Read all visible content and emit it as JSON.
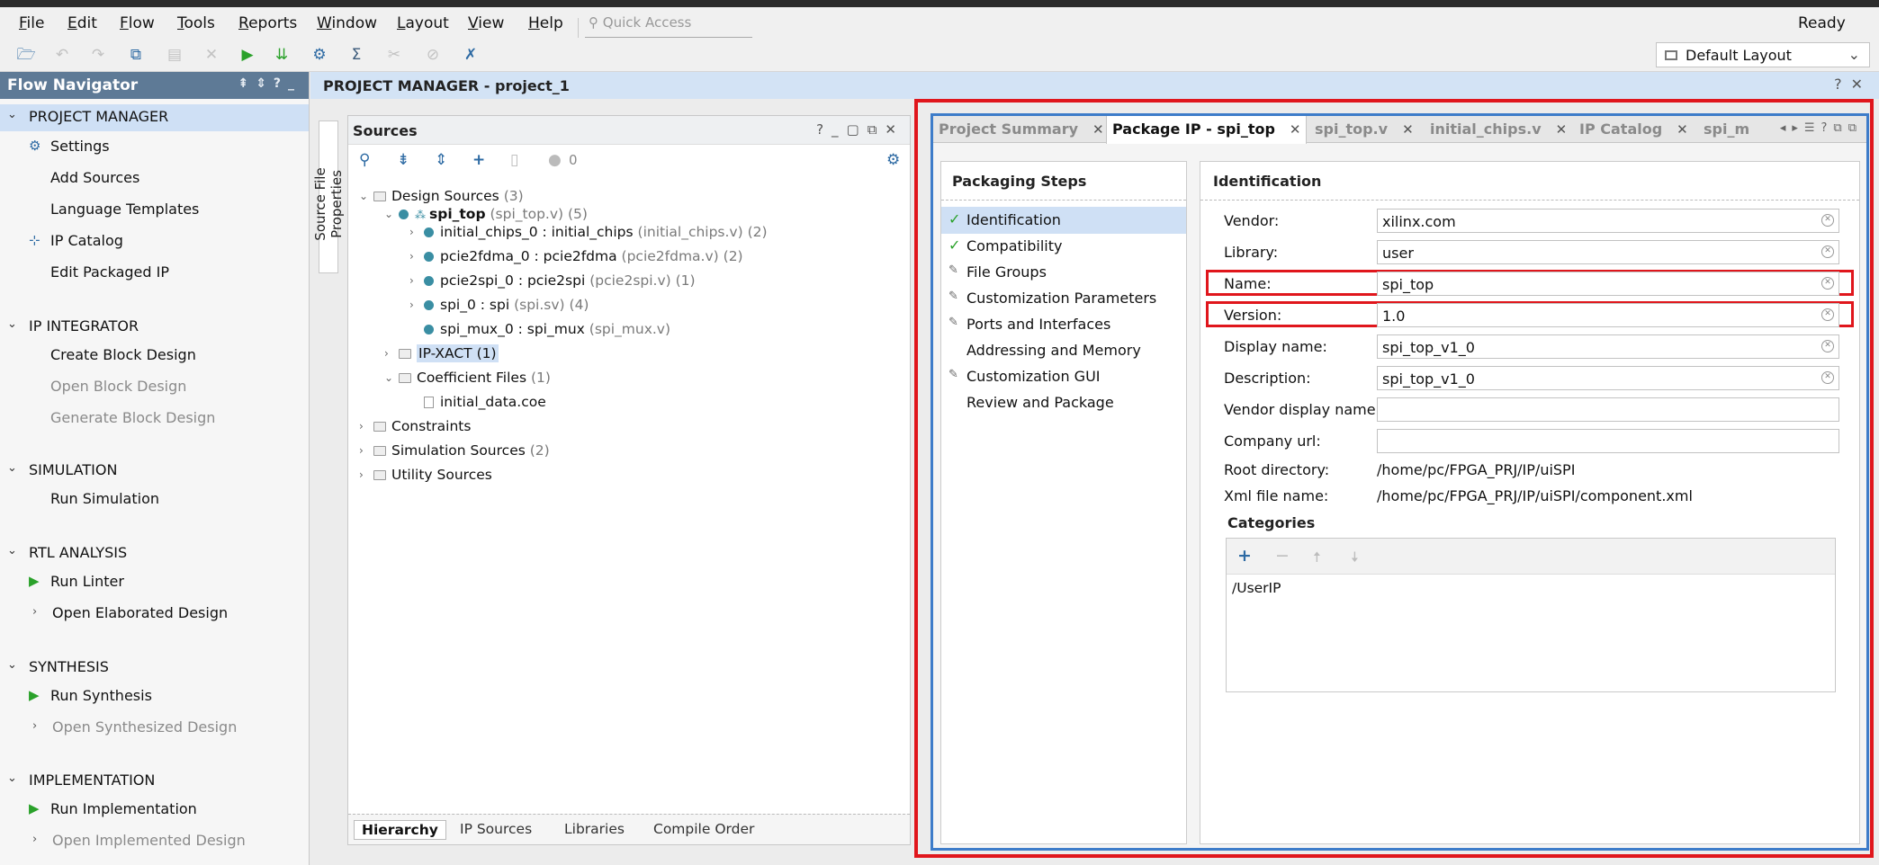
{
  "menubar": {
    "items": [
      "File",
      "Edit",
      "Flow",
      "Tools",
      "Reports",
      "Window",
      "Layout",
      "View",
      "Help"
    ],
    "quick_access_placeholder": "Quick Access",
    "status": "Ready"
  },
  "toolbar": {
    "layout_select": "Default Layout"
  },
  "flow_navigator": {
    "title": "Flow Navigator",
    "sections": {
      "project_manager": {
        "title": "PROJECT MANAGER",
        "items": [
          "Settings",
          "Add Sources",
          "Language Templates",
          "IP Catalog",
          "Edit Packaged IP"
        ]
      },
      "ip_integrator": {
        "title": "IP INTEGRATOR",
        "items": [
          "Create Block Design",
          "Open Block Design",
          "Generate Block Design"
        ]
      },
      "simulation": {
        "title": "SIMULATION",
        "items": [
          "Run Simulation"
        ]
      },
      "rtl_analysis": {
        "title": "RTL ANALYSIS",
        "items": [
          "Run Linter",
          "Open Elaborated Design"
        ]
      },
      "synthesis": {
        "title": "SYNTHESIS",
        "items": [
          "Run Synthesis",
          "Open Synthesized Design"
        ]
      },
      "implementation": {
        "title": "IMPLEMENTATION",
        "items": [
          "Run Implementation",
          "Open Implemented Design"
        ]
      }
    }
  },
  "main_header": {
    "title": "PROJECT MANAGER - project_1"
  },
  "side_tab": "Source File Properties",
  "sources": {
    "title": "Sources",
    "count_badge": "0",
    "tree": {
      "design_sources": {
        "label": "Design Sources",
        "count": "(3)"
      },
      "spi_top": {
        "label": "spi_top",
        "file": "(spi_top.v)",
        "count": "(5)"
      },
      "children": [
        {
          "label": "initial_chips_0 : initial_chips",
          "file": "(initial_chips.v)",
          "count": "(2)"
        },
        {
          "label": "pcie2fdma_0 : pcie2fdma",
          "file": "(pcie2fdma.v)",
          "count": "(2)"
        },
        {
          "label": "pcie2spi_0 : pcie2spi",
          "file": "(pcie2spi.v)",
          "count": "(1)"
        },
        {
          "label": "spi_0 : spi",
          "file": "(spi.sv)",
          "count": "(4)"
        },
        {
          "label": "spi_mux_0 : spi_mux",
          "file": "(spi_mux.v)",
          "count": ""
        }
      ],
      "ip_xact": "IP-XACT (1)",
      "coefficient_files": {
        "label": "Coefficient Files",
        "count": "(1)"
      },
      "coe_file": "initial_data.coe",
      "constraints": "Constraints",
      "simulation_sources": {
        "label": "Simulation Sources",
        "count": "(2)"
      },
      "utility_sources": "Utility Sources"
    },
    "bottom_tabs": [
      "Hierarchy",
      "IP Sources",
      "Libraries",
      "Compile Order"
    ]
  },
  "editor": {
    "tabs": [
      {
        "label": "Project Summary"
      },
      {
        "label": "Package IP - spi_top"
      },
      {
        "label": "spi_top.v"
      },
      {
        "label": "initial_chips.v"
      },
      {
        "label": "IP Catalog"
      },
      {
        "label": "spi_m"
      }
    ],
    "packaging_steps": {
      "title": "Packaging Steps",
      "steps": [
        "Identification",
        "Compatibility",
        "File Groups",
        "Customization Parameters",
        "Ports and Interfaces",
        "Addressing and Memory",
        "Customization GUI",
        "Review and Package"
      ]
    },
    "identification": {
      "title": "Identification",
      "vendor": {
        "label": "Vendor:",
        "value": "xilinx.com"
      },
      "library": {
        "label": "Library:",
        "value": "user"
      },
      "name": {
        "label": "Name:",
        "value": "spi_top"
      },
      "version": {
        "label": "Version:",
        "value": "1.0"
      },
      "display_name": {
        "label": "Display name:",
        "value": "spi_top_v1_0"
      },
      "description": {
        "label": "Description:",
        "value": "spi_top_v1_0"
      },
      "vendor_display_name": {
        "label": "Vendor display name:",
        "value": ""
      },
      "company_url": {
        "label": "Company url:",
        "value": ""
      },
      "root_directory": {
        "label": "Root directory:",
        "value": "/home/pc/FPGA_PRJ/IP/uiSPI"
      },
      "xml_file_name": {
        "label": "Xml file name:",
        "value": "/home/pc/FPGA_PRJ/IP/uiSPI/component.xml"
      },
      "categories": {
        "title": "Categories",
        "items": [
          "/UserIP"
        ]
      }
    }
  },
  "colors": {
    "highlight_red": "#e0161c",
    "editor_blue": "#3d7cc9",
    "selection": "#cfe0f5",
    "nav_header": "#5e7a96"
  }
}
